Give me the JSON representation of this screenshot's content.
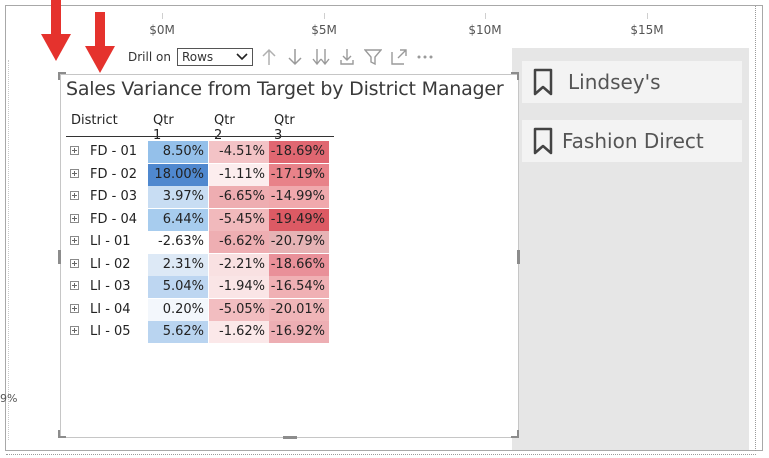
{
  "axis": {
    "ticks": [
      "$0M",
      "$5M",
      "$10M",
      "$15M"
    ]
  },
  "side_fragment": "9%",
  "cards": [
    {
      "icon": "bookmark-icon",
      "label": "Lindsey's"
    },
    {
      "icon": "bookmark-icon",
      "label": "Fashion Direct"
    }
  ],
  "drill": {
    "label": "Drill on",
    "selected": "Rows"
  },
  "visual": {
    "title": "Sales Variance from Target by District Manager",
    "columns": [
      "District",
      "Qtr 1",
      "Qtr 2",
      "Qtr 3"
    ],
    "rows": [
      {
        "district": "FD - 01",
        "q1": "8.50%",
        "q2": "-4.51%",
        "q3": "-18.69%"
      },
      {
        "district": "FD - 02",
        "q1": "18.00%",
        "q2": "-1.11%",
        "q3": "-17.19%"
      },
      {
        "district": "FD - 03",
        "q1": "3.97%",
        "q2": "-6.65%",
        "q3": "-14.99%"
      },
      {
        "district": "FD - 04",
        "q1": "6.44%",
        "q2": "-5.45%",
        "q3": "-19.49%"
      },
      {
        "district": "LI - 01",
        "q1": "-2.63%",
        "q2": "-6.62%",
        "q3": "-20.79%"
      },
      {
        "district": "LI - 02",
        "q1": "2.31%",
        "q2": "-2.21%",
        "q3": "-18.66%"
      },
      {
        "district": "LI - 03",
        "q1": "5.04%",
        "q2": "-1.94%",
        "q3": "-16.54%"
      },
      {
        "district": "LI - 04",
        "q1": "0.20%",
        "q2": "-5.05%",
        "q3": "-20.01%"
      },
      {
        "district": "LI - 05",
        "q1": "5.62%",
        "q2": "-1.62%",
        "q3": "-16.92%"
      }
    ],
    "cell_colors": {
      "q1": [
        "#94c0ea",
        "#4f88cf",
        "#c8ddf3",
        "#a7ccee",
        "#ffffff",
        "#dde9f6",
        "#bdd6f1",
        "#f3f7fc",
        "#b9d4f0"
      ],
      "q2": [
        "#f3c3c6",
        "#fcedee",
        "#eeadb1",
        "#f1b9bc",
        "#eeaeb2",
        "#f9e1e2",
        "#fae5e6",
        "#f2bdc0",
        "#fbe8e9"
      ],
      "q3": [
        "#e06771",
        "#e88289",
        "#f0a9ad",
        "#dc5a64",
        "#e6b3b5",
        "#e99099",
        "#f0b0b4",
        "#f0b5b8",
        "#edaeb3"
      ]
    }
  },
  "colors": {
    "arrow": "#e5322d",
    "gray_panel": "#e6e6e6",
    "border": "#a8a8a8"
  }
}
